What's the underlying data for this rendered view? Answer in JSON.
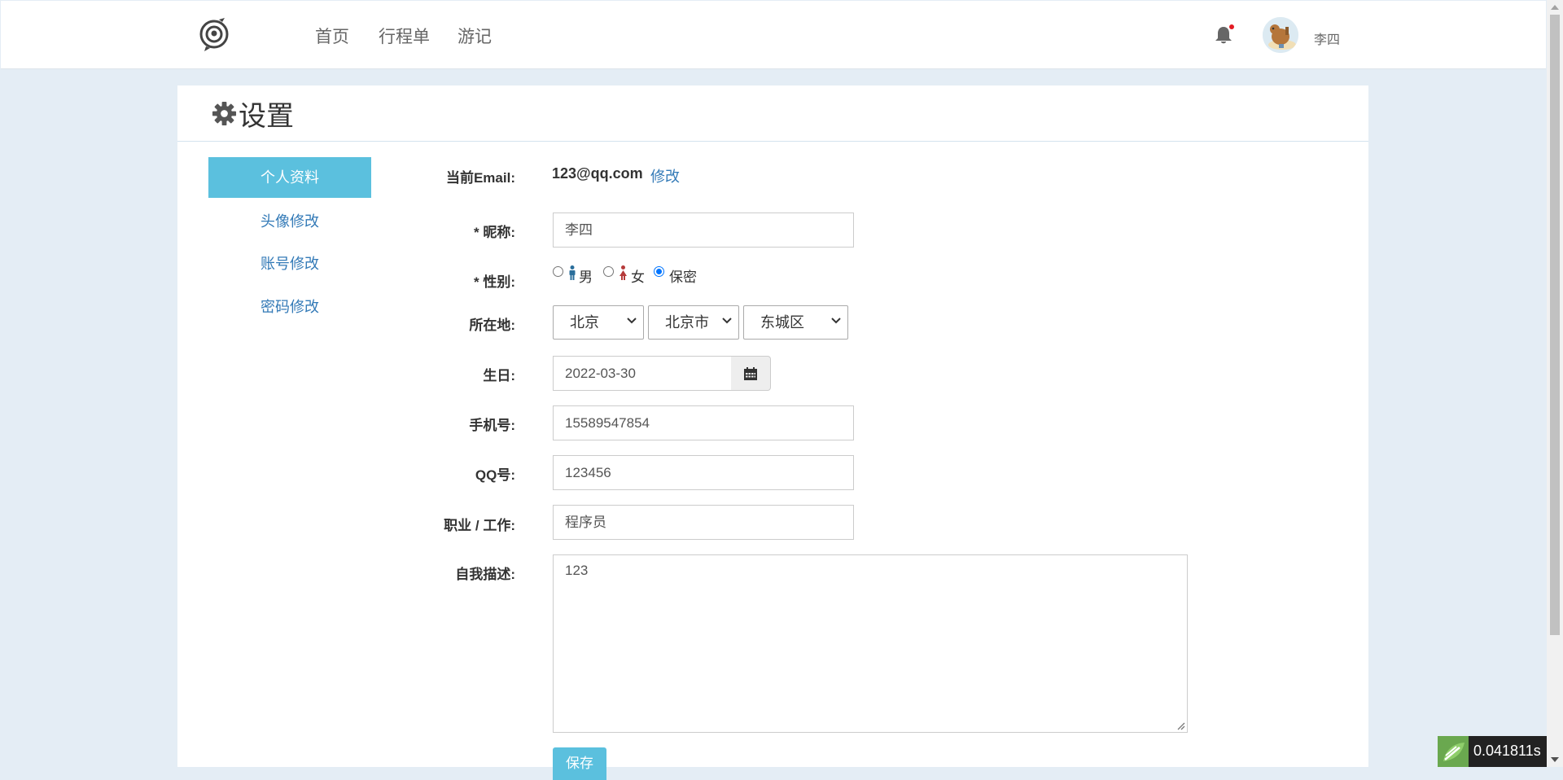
{
  "nav": {
    "items": [
      {
        "label": "首页"
      },
      {
        "label": "行程单"
      },
      {
        "label": "游记"
      }
    ],
    "username": "李四"
  },
  "page": {
    "title": "设置"
  },
  "menu": {
    "items": [
      {
        "label": "个人资料",
        "active": true
      },
      {
        "label": "头像修改"
      },
      {
        "label": "账号修改"
      },
      {
        "label": "密码修改"
      }
    ]
  },
  "form": {
    "email_label": "当前Email:",
    "email_value": "123@qq.com",
    "email_edit": "修改",
    "nickname_label": "* 昵称:",
    "nickname_value": "李四",
    "gender_label": "* 性别:",
    "gender_options": [
      {
        "label": "男",
        "selected": false
      },
      {
        "label": "女",
        "selected": false
      },
      {
        "label": "保密",
        "selected": true
      }
    ],
    "location_label": "所在地:",
    "province": "北京",
    "city": "北京市",
    "district": "东城区",
    "birthday_label": "生日:",
    "birthday_value": "2022-03-30",
    "phone_label": "手机号:",
    "phone_value": "15589547854",
    "qq_label": "QQ号:",
    "qq_value": "123456",
    "job_label": "职业 / 工作:",
    "job_value": "程序员",
    "desc_label": "自我描述:",
    "desc_value": "123",
    "save_label": "保存"
  },
  "timing": {
    "text": "0.041811s"
  },
  "colors": {
    "accent": "#5bc0de",
    "link": "#337ab7",
    "background": "#e4edf5"
  }
}
